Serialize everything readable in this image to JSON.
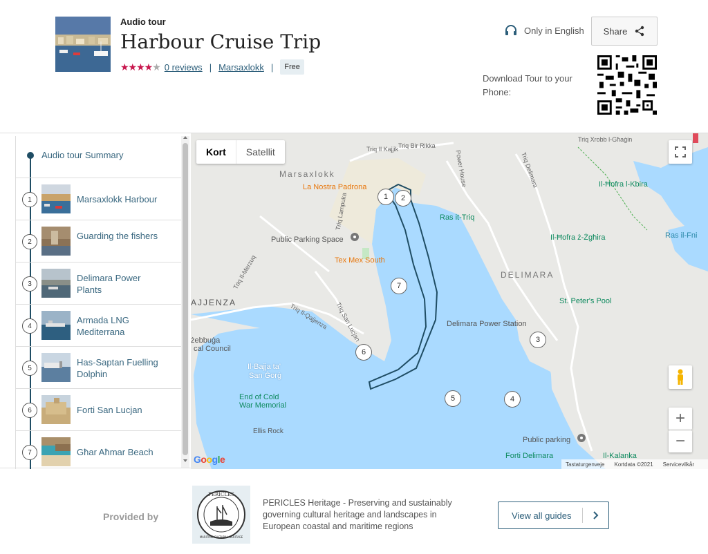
{
  "tour": {
    "kicker": "Audio tour",
    "title": "Harbour Cruise Trip",
    "rating_stars": 4,
    "reviews": "0 reviews",
    "location": "Marsaxlokk",
    "price": "Free",
    "language": "Only in English",
    "share": "Share",
    "download_text": "Download Tour to your Phone:"
  },
  "stops": {
    "summary": "Audio tour Summary",
    "items": [
      {
        "num": "1",
        "label": "Marsaxlokk Harbour"
      },
      {
        "num": "2",
        "label": "Guarding the fishers"
      },
      {
        "num": "3",
        "label": "Delimara Power Plants"
      },
      {
        "num": "4",
        "label": "Armada LNG Mediterrana"
      },
      {
        "num": "5",
        "label": "Has-Saptan Fuelling Dolphin"
      },
      {
        "num": "6",
        "label": "Forti San Lucjan"
      },
      {
        "num": "7",
        "label": "Għar Aħmar Beach"
      }
    ]
  },
  "map": {
    "type_map": "Kort",
    "type_satellite": "Satellit",
    "labels": {
      "marsaxlokk": "Marsaxlokk",
      "la_nostra": "La Nostra Padrona",
      "public_parking": "Public Parking Space",
      "tex_mex": "Tex Mex South",
      "ras_it_triq": "Ras it-Triq",
      "delimara": "DELIMARA",
      "st_peters": "St. Peter's Pool",
      "power_station": "Delimara Power Station",
      "il_mofra_kbira": "Il-Ħofra l-Kbira",
      "il_mofra_zghira": "Il-Ħofra ż-Żgħira",
      "ras_il_fni": "Ras il-Fni",
      "ajjenza": "AJJENZA",
      "zebbuga": "żebbuġa",
      "council": "cal Council",
      "il_bajja": "Il-Bajja ta'",
      "san_gorg": "San Ġorġ",
      "end_cold": "End of Cold",
      "war_memorial": "War Memorial",
      "ellis_rock": "Ellis Rock",
      "public_parking2": "Public parking",
      "forti_delimara": "Forti Delimara",
      "il_kalanka": "Il-Kalanka",
      "triq_il_kajjik": "Triq Il Kajjik",
      "triq_bir_rikka": "Triq Bir Rikka",
      "triq_xrobb": "Triq Xrobb l-Għaġin",
      "triq_delimara": "Triq Delimara",
      "power_house": "Power House",
      "triq_il_qajjenza": "Triq Il-Qajjenza",
      "triq_san_lucjan": "Triq San Lucjan",
      "triq_il_merzuq": "Triq Il-Merzuq",
      "triq_lampuka": "Triq Lampuka"
    },
    "markers": [
      "1",
      "2",
      "3",
      "4",
      "5",
      "6",
      "7"
    ],
    "google": "Google",
    "attribution": {
      "shortcuts": "Tastaturgenveje",
      "data": "Kortdata ©2021",
      "terms": "Servicevilkår"
    }
  },
  "footer": {
    "provided_by": "Provided by",
    "logo_text": "PERICLES",
    "logo_subtext": "MARITIME CULTURAL HERITAGE",
    "description": "PERICLES Heritage - Preserving and sustainably governing cultural heritage and landscapes in European coastal and maritime regions",
    "view_all": "View all guides"
  },
  "colors": {
    "accent": "#2c5e7a",
    "star": "#c8164d",
    "water": "#aadaff",
    "route": "#1f4d64"
  }
}
